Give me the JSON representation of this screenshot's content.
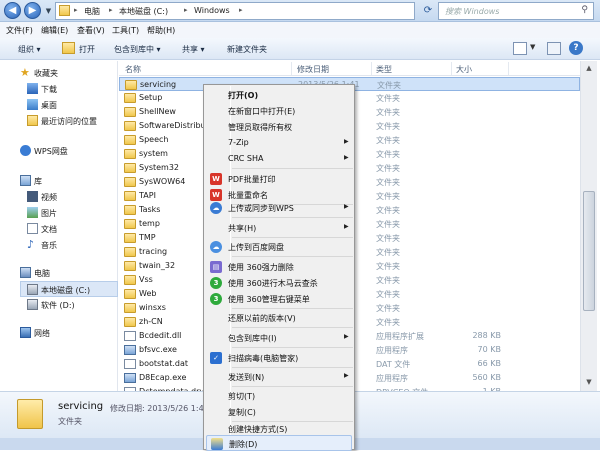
{
  "address": {
    "crumbs": [
      "电脑",
      "本地磁盘 (C:)",
      "Windows"
    ],
    "search_placeholder": "搜索 Windows"
  },
  "menubar": [
    "文件(F)",
    "编辑(E)",
    "查看(V)",
    "工具(T)",
    "帮助(H)"
  ],
  "toolbar": {
    "organize": "组织 ▾",
    "open": "打开",
    "include": "包含到库中 ▾",
    "share": "共享 ▾",
    "new_folder": "新建文件夹"
  },
  "nav": {
    "favorites": "收藏夹",
    "downloads": "下载",
    "desktop": "桌面",
    "recent": "最近访问的位置",
    "wps": "WPS网盘",
    "library": "库",
    "videos": "视频",
    "pictures": "图片",
    "documents": "文档",
    "music": "音乐",
    "computer": "电脑",
    "local_disk": "本地磁盘 (C:)",
    "soft_disk": "软件 (D:)",
    "network": "网络"
  },
  "columns": {
    "name": "名称",
    "date": "修改日期",
    "type": "类型",
    "size": "大小"
  },
  "files": [
    {
      "name": "servicing",
      "date": "2013/5/26 1:41",
      "type": "文件夹",
      "size": "",
      "kind": "folder"
    },
    {
      "name": "Setup",
      "date": "",
      "type": "文件夹",
      "size": "",
      "kind": "folder"
    },
    {
      "name": "ShellNew",
      "date": "",
      "type": "文件夹",
      "size": "",
      "kind": "folder"
    },
    {
      "name": "SoftwareDistribut",
      "date": "",
      "type": "文件夹",
      "size": "",
      "kind": "folder"
    },
    {
      "name": "Speech",
      "date": "",
      "type": "文件夹",
      "size": "",
      "kind": "folder"
    },
    {
      "name": "system",
      "date": "",
      "type": "文件夹",
      "size": "",
      "kind": "folder"
    },
    {
      "name": "System32",
      "date": "",
      "type": "文件夹",
      "size": "",
      "kind": "folder"
    },
    {
      "name": "SysWOW64",
      "date": "",
      "type": "文件夹",
      "size": "",
      "kind": "folder"
    },
    {
      "name": "TAPI",
      "date": "",
      "type": "文件夹",
      "size": "",
      "kind": "folder"
    },
    {
      "name": "Tasks",
      "date": "",
      "type": "文件夹",
      "size": "",
      "kind": "folder"
    },
    {
      "name": "temp",
      "date": "",
      "type": "文件夹",
      "size": "",
      "kind": "folder"
    },
    {
      "name": "TMP",
      "date": "",
      "type": "文件夹",
      "size": "",
      "kind": "folder"
    },
    {
      "name": "tracing",
      "date": "",
      "type": "文件夹",
      "size": "",
      "kind": "folder"
    },
    {
      "name": "twain_32",
      "date": "",
      "type": "文件夹",
      "size": "",
      "kind": "folder"
    },
    {
      "name": "Vss",
      "date": "",
      "type": "文件夹",
      "size": "",
      "kind": "folder"
    },
    {
      "name": "Web",
      "date": "",
      "type": "文件夹",
      "size": "",
      "kind": "folder"
    },
    {
      "name": "winsxs",
      "date": "",
      "type": "文件夹",
      "size": "",
      "kind": "folder"
    },
    {
      "name": "zh-CN",
      "date": "",
      "type": "文件夹",
      "size": "",
      "kind": "folder"
    },
    {
      "name": "Bcdedit.dll",
      "date": "",
      "type": "应用程序扩展",
      "size": "288 KB",
      "kind": "file"
    },
    {
      "name": "bfsvc.exe",
      "date": "",
      "type": "应用程序",
      "size": "70 KB",
      "kind": "exe"
    },
    {
      "name": "bootstat.dat",
      "date": "",
      "type": "DAT 文件",
      "size": "66 KB",
      "kind": "file"
    },
    {
      "name": "D8Ecap.exe",
      "date": "",
      "type": "应用程序",
      "size": "560 KB",
      "kind": "exe"
    },
    {
      "name": "Dctempdata.drvc",
      "date": "",
      "type": "DRVCEO 文件",
      "size": "1 KB",
      "kind": "file"
    }
  ],
  "details": {
    "name": "servicing",
    "meta": "修改日期: 2013/5/26 1:41",
    "type": "文件夹"
  },
  "context_menu": {
    "open": "打开(O)",
    "open_new_window": "在新窗口中打开(E)",
    "take_ownership": "管理员取得所有权",
    "zip7": "7-Zip",
    "crc": "CRC SHA",
    "pdf_print": "PDF批量打印",
    "batch_rename": "批量重命名",
    "upload_wps": "上传或同步到WPS",
    "share": "共享(H)",
    "upload_baidu": "上传到百度网盘",
    "force_delete_360": "使用 360强力删除",
    "scan_360": "使用 360进行木马云查杀",
    "manage_360": "使用 360管理右键菜单",
    "restore": "还原以前的版本(V)",
    "include_library": "包含到库中(I)",
    "scan_virus": "扫描病毒(电脑管家)",
    "send_to": "发送到(N)",
    "cut": "剪切(T)",
    "copy": "复制(C)",
    "create_shortcut": "创建快捷方式(S)",
    "delete": "删除(D)"
  }
}
